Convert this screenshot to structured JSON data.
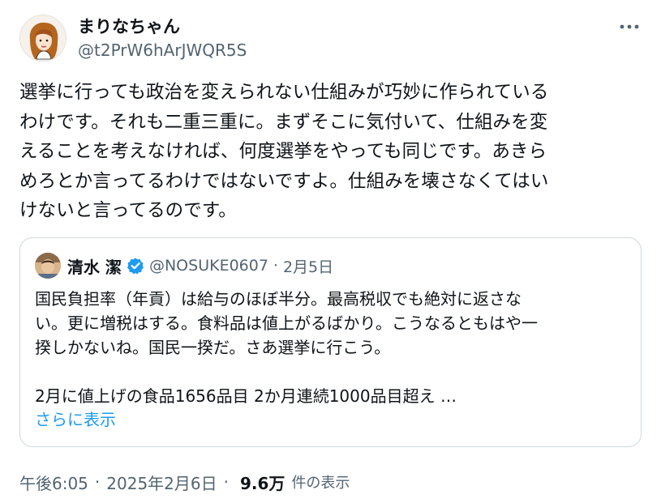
{
  "author": {
    "display_name": "まりなちゃん",
    "handle": "@t2PrW6hArJWQR5S"
  },
  "tweet": {
    "text": "選挙に行っても政治を変えられない仕組みが巧妙に作られている\nわけです。それも二重三重に。まずそこに気付いて、仕組みを変\nえることを考えなければ、何度選挙をやっても同じです。あきら\nめろとか言ってるわけではないですよ。仕組みを壊さなくてはい\nけないと言ってるのです。"
  },
  "quote": {
    "display_name": "清水 潔",
    "handle": "@NOSUKE0607",
    "separator": "·",
    "date": "2月5日",
    "text": "国民負担率（年貢）は給与のほぼ半分。最高税収でも絶対に返さな\nい。更に増税はする。食料品は値上がるばかり。こうなるともはや一\n揆しかないね。国民一揆だ。さあ選挙に行こう。\n\n2月に値上げの食品1656品目 2か月連続1000品目超え …",
    "show_more": "さらに表示"
  },
  "meta": {
    "time": "午後6:05",
    "separator": "·",
    "date": "2025年2月6日",
    "views": "9.6万",
    "views_label": "件の表示"
  },
  "icons": {
    "more": "more-horizontal-icon",
    "verified": "verified-badge-icon"
  },
  "colors": {
    "text": "#0f1419",
    "secondary": "#536471",
    "link": "#1d9bf0",
    "border": "#cfd9de"
  }
}
